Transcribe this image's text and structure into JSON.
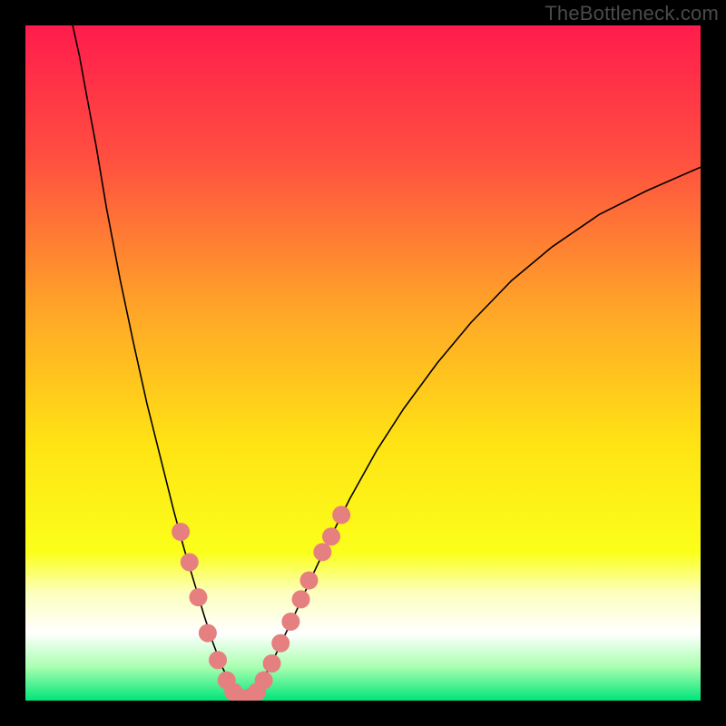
{
  "watermark": "TheBottleneck.com",
  "chart_data": {
    "type": "line",
    "title": "",
    "xlabel": "",
    "ylabel": "",
    "xlim": [
      0,
      100
    ],
    "ylim": [
      0,
      100
    ],
    "grid": false,
    "legend": false,
    "background_gradient": {
      "stops": [
        {
          "offset": 0.0,
          "color": "#ff1c4c"
        },
        {
          "offset": 0.2,
          "color": "#ff5040"
        },
        {
          "offset": 0.42,
          "color": "#ffa528"
        },
        {
          "offset": 0.62,
          "color": "#ffe314"
        },
        {
          "offset": 0.78,
          "color": "#fbff1a"
        },
        {
          "offset": 0.84,
          "color": "#fcffbd"
        },
        {
          "offset": 0.9,
          "color": "#ffffff"
        },
        {
          "offset": 0.95,
          "color": "#aaffb0"
        },
        {
          "offset": 1.0,
          "color": "#00e57a"
        }
      ]
    },
    "series": [
      {
        "name": "bottleneck-curve-left",
        "color": "#000000",
        "width": 1.6,
        "x": [
          7.0,
          8.0,
          9.0,
          10.5,
          12.0,
          14.0,
          16.0,
          18.0,
          20.0,
          22.0,
          23.5,
          25.0,
          26.5,
          27.8,
          29.0,
          30.0,
          31.0,
          31.8,
          32.5
        ],
        "y": [
          100,
          95.5,
          90.0,
          82.0,
          73.0,
          62.5,
          53.0,
          44.0,
          36.0,
          28.0,
          22.5,
          17.5,
          12.5,
          8.5,
          5.3,
          3.2,
          1.6,
          0.6,
          0.0
        ]
      },
      {
        "name": "bottleneck-curve-right",
        "color": "#000000",
        "width": 1.6,
        "x": [
          32.5,
          33.2,
          34.2,
          35.2,
          36.5,
          38.0,
          40.0,
          42.5,
          45.0,
          48.0,
          52.0,
          56.0,
          61.0,
          66.0,
          72.0,
          78.0,
          85.0,
          92.0,
          100.0
        ],
        "y": [
          0.0,
          0.6,
          1.6,
          3.2,
          5.6,
          8.8,
          13.0,
          18.5,
          23.8,
          29.8,
          37.0,
          43.2,
          50.0,
          56.0,
          62.2,
          67.2,
          72.0,
          75.5,
          79.0
        ]
      }
    ],
    "scatter": {
      "name": "benchmark-points",
      "color": "#e68080",
      "radius": 10,
      "points": [
        {
          "x": 23.0,
          "y": 25.0
        },
        {
          "x": 24.3,
          "y": 20.5
        },
        {
          "x": 25.6,
          "y": 15.3
        },
        {
          "x": 27.0,
          "y": 10.0
        },
        {
          "x": 28.5,
          "y": 6.0
        },
        {
          "x": 29.8,
          "y": 3.0
        },
        {
          "x": 30.8,
          "y": 1.3
        },
        {
          "x": 31.6,
          "y": 0.5
        },
        {
          "x": 32.4,
          "y": 0.1
        },
        {
          "x": 33.3,
          "y": 0.5
        },
        {
          "x": 34.3,
          "y": 1.3
        },
        {
          "x": 35.3,
          "y": 3.0
        },
        {
          "x": 36.5,
          "y": 5.5
        },
        {
          "x": 37.8,
          "y": 8.5
        },
        {
          "x": 39.3,
          "y": 11.7
        },
        {
          "x": 40.8,
          "y": 15.0
        },
        {
          "x": 42.0,
          "y": 17.8
        },
        {
          "x": 44.0,
          "y": 22.0
        },
        {
          "x": 45.3,
          "y": 24.3
        },
        {
          "x": 46.8,
          "y": 27.5
        }
      ]
    }
  }
}
